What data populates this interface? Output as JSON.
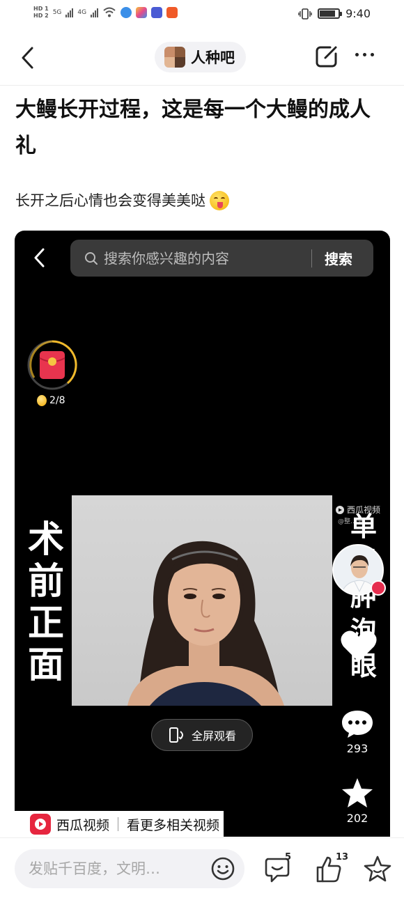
{
  "status_bar": {
    "hd1": "HD 1",
    "hd2": "HD 2",
    "net1": "5G",
    "net2": "4G",
    "time": "9:40",
    "battery_level": 0.85
  },
  "header": {
    "forum_name": "人种吧"
  },
  "post": {
    "title": "大鳗长开过程，这是每一个大鳗的成人礼",
    "body": "长开之后心情也会变得美美哒"
  },
  "video": {
    "search_placeholder": "搜索你感兴趣的内容",
    "search_button": "搜索",
    "coin_progress": "2/8",
    "left_caption": "术前正面",
    "right_caption": "单眼肿泡眼",
    "watermark": "西瓜视频",
    "watermark_sub": "@整…宁",
    "fullscreen_label": "全屏观看",
    "comments_count": "293",
    "stars_count": "202",
    "xigua_brand": "西瓜视频",
    "xigua_more": "看更多相关视频"
  },
  "bottom_bar": {
    "reply_placeholder": "发贴千百度，文明…",
    "comment_count": "5",
    "like_count": "13"
  },
  "colors": {
    "accent_red": "#e6263f",
    "video_bg": "#000000",
    "pill_bg": "#f2f2f5"
  }
}
